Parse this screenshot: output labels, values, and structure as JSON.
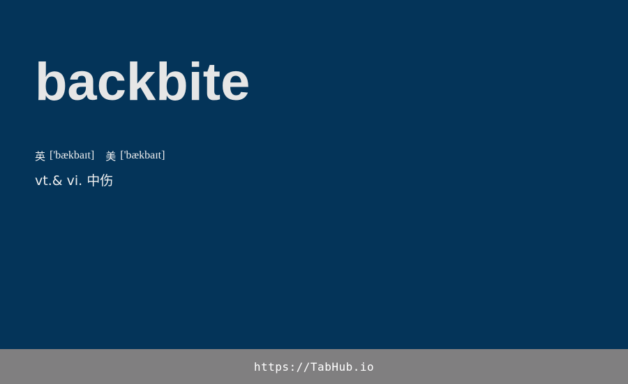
{
  "card": {
    "word": "backbite",
    "phonetics": {
      "uk_label": "英",
      "uk_ipa": "['bækbaɪt]",
      "us_label": "美",
      "us_ipa": "['bækbaɪt]"
    },
    "definition": "vt.& vi. 中伤",
    "background_color": "#043459"
  },
  "footer": {
    "link_text": "https://TabHub.io",
    "background_color": "#807f80"
  }
}
